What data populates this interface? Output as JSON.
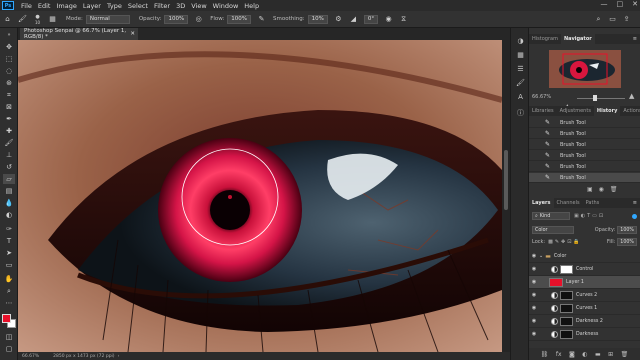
{
  "app": {
    "logo_text": "Ps",
    "menu": [
      "File",
      "Edit",
      "Image",
      "Layer",
      "Type",
      "Select",
      "Filter",
      "3D",
      "View",
      "Window",
      "Help"
    ],
    "window_controls": [
      "—",
      "□",
      "✕"
    ]
  },
  "options_bar": {
    "brush_size": "10",
    "mode_label": "Mode:",
    "mode_value": "Normal",
    "opacity_label": "Opacity:",
    "opacity_value": "100%",
    "flow_label": "Flow:",
    "flow_value": "100%",
    "smoothing_label": "Smoothing:",
    "smoothing_value": "10%",
    "angle_value": "0°"
  },
  "document": {
    "tab_title": "Photoshop Senpai @ 66.7% (Layer 1, RGB/8) *",
    "zoom": "66.67%",
    "dimensions": "2850 px x 1473 px (72 ppi)"
  },
  "navigator": {
    "tabs": [
      "Histogram",
      "Navigator"
    ],
    "active_tab": "Navigator",
    "zoom": "66.67%"
  },
  "history": {
    "tabs": [
      "Libraries",
      "Adjustments",
      "History",
      "Actions"
    ],
    "active_tab": "History",
    "items": [
      "Brush Tool",
      "Brush Tool",
      "Brush Tool",
      "Brush Tool",
      "Brush Tool",
      "Brush Tool"
    ],
    "selected_index": 5
  },
  "layers": {
    "tabs": [
      "Layers",
      "Channels",
      "Paths"
    ],
    "active_tab": "Layers",
    "filter_kind": "Kind",
    "blend_mode": "Color",
    "opacity_label": "Opacity:",
    "opacity_value": "100%",
    "lock_label": "Lock:",
    "fill_label": "Fill:",
    "fill_value": "100%",
    "items": [
      {
        "name": "Color",
        "type": "group"
      },
      {
        "name": "Control",
        "type": "layer"
      },
      {
        "name": "Layer 1",
        "type": "pixel"
      },
      {
        "name": "Curves 2",
        "type": "adjustment"
      },
      {
        "name": "Curves 1",
        "type": "adjustment"
      },
      {
        "name": "Darkness 2",
        "type": "adjustment"
      },
      {
        "name": "Darkness",
        "type": "adjustment"
      }
    ],
    "selected_index": 2
  },
  "colors": {
    "foreground": "#e8102a",
    "background": "#ffffff",
    "accent": "#31a8ff"
  }
}
